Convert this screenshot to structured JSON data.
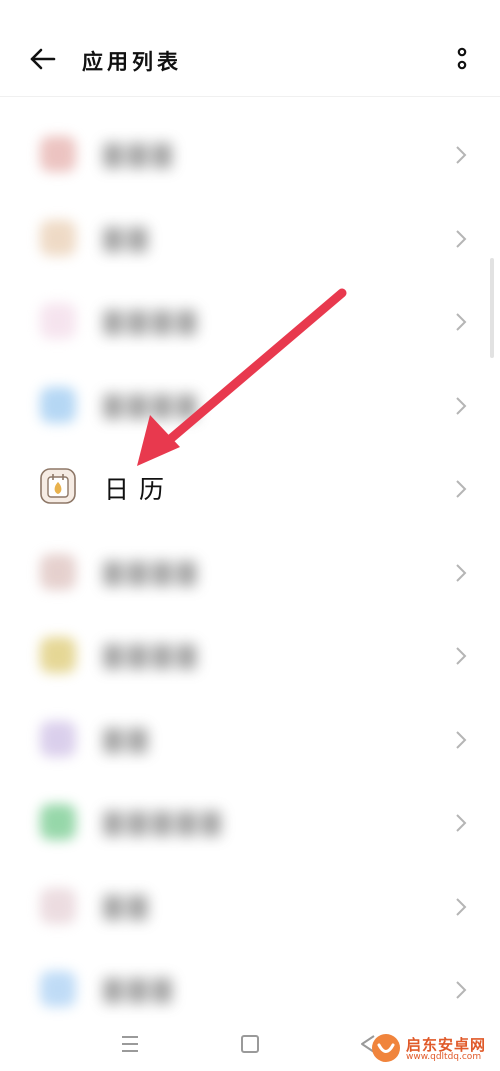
{
  "header": {
    "title": "应用列表",
    "back_icon": "arrow-left-icon",
    "more_icon": "more-vertical-icon"
  },
  "apps": [
    {
      "name": "",
      "blurred": true,
      "color": "#e2a4a0"
    },
    {
      "name": "",
      "blurred": true,
      "color": "#e6c7a8"
    },
    {
      "name": "",
      "blurred": true,
      "color": "#f1d6e6"
    },
    {
      "name": "",
      "blurred": true,
      "color": "#8ec2ef"
    },
    {
      "name": "日历",
      "blurred": false,
      "color": "#f6ece4",
      "icon": "calendar-icon"
    },
    {
      "name": "",
      "blurred": true,
      "color": "#d8b8b4"
    },
    {
      "name": "",
      "blurred": true,
      "color": "#d8c25e"
    },
    {
      "name": "",
      "blurred": true,
      "color": "#c7b6e2"
    },
    {
      "name": "",
      "blurred": true,
      "color": "#5fc27c"
    },
    {
      "name": "",
      "blurred": true,
      "color": "#e2cad0"
    },
    {
      "name": "",
      "blurred": true,
      "color": "#9ec9f2"
    }
  ],
  "annotation": {
    "arrow_color": "#e8394e"
  },
  "navbar": {
    "icons": [
      "menu-icon",
      "home-square-icon",
      "back-triangle-icon"
    ]
  },
  "watermark": {
    "text": "启东安卓网",
    "url": "www.qdltdq.com"
  }
}
